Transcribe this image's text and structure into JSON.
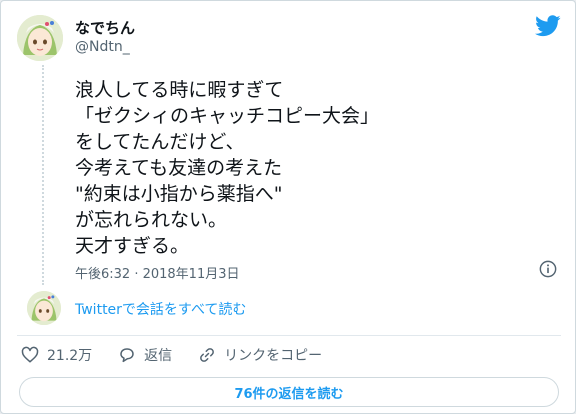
{
  "user": {
    "display_name": "なでちん",
    "handle": "@Ndtn_"
  },
  "tweet": {
    "lines": [
      "浪人してる時に暇すぎて",
      "「ゼクシィのキャッチコピー大会」",
      "をしてたんだけど、",
      "今考えても友達の考えた",
      "\"約束は小指から薬指へ\"",
      "が忘れられない。",
      "天才すぎる。"
    ],
    "timestamp": "午後6:32 · 2018年11月3日"
  },
  "conversation_link": "Twitterで会話をすべて読む",
  "actions": {
    "likes": "21.2万",
    "reply": "返信",
    "copy_link": "リンクをコピー"
  },
  "replies_button": "76件の返信を読む",
  "colors": {
    "accent": "#1d9bf0",
    "text": "#0f1419",
    "secondary": "#536471",
    "border": "#cfd9de"
  },
  "icons": [
    "twitter-bird-icon",
    "info-icon",
    "heart-icon",
    "reply-bubble-icon",
    "link-icon"
  ]
}
